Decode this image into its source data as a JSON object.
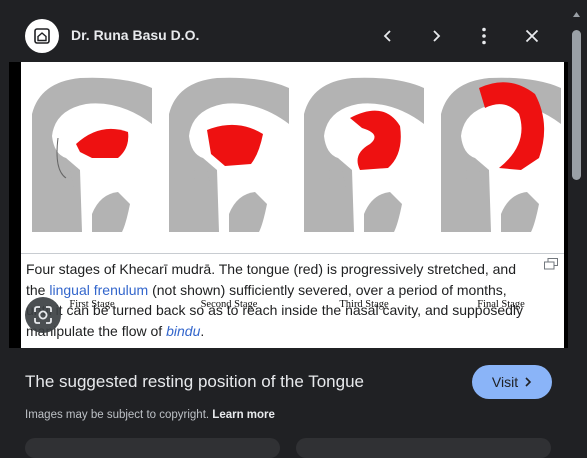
{
  "header": {
    "site_name": "Dr. Runa Basu D.O.",
    "logo_icon": "home-icon",
    "prev_icon": "chevron-left-icon",
    "next_icon": "chevron-right-icon",
    "more_icon": "more-vert-icon",
    "close_icon": "close-icon"
  },
  "figure": {
    "stages": [
      "First Stage",
      "Second Stage",
      "Third Stage",
      "Final Stage"
    ],
    "caption": {
      "part1": "Four stages of Khecarī mudrā. The tongue (red) is progressively stretched, and the ",
      "link1": "lingual frenulum",
      "part2": " (not shown) sufficiently severed, over a period of months, until it can be turned back so as to reach inside the nasal cavity, and supposedly manipulate the flow of ",
      "link2": "bindu",
      "part3": "."
    },
    "tongue_color": "#ee1111",
    "anatomy_color": "#b3b3b3"
  },
  "lens": {
    "icon": "google-lens-icon"
  },
  "result": {
    "title": "The suggested resting position of the Tongue",
    "visit_label": "Visit",
    "visit_icon": "chevron-right-icon",
    "copyright_text": "Images may be subject to copyright.",
    "learn_more": "Learn more"
  },
  "colors": {
    "accent": "#8ab4f8",
    "background": "#202124"
  }
}
